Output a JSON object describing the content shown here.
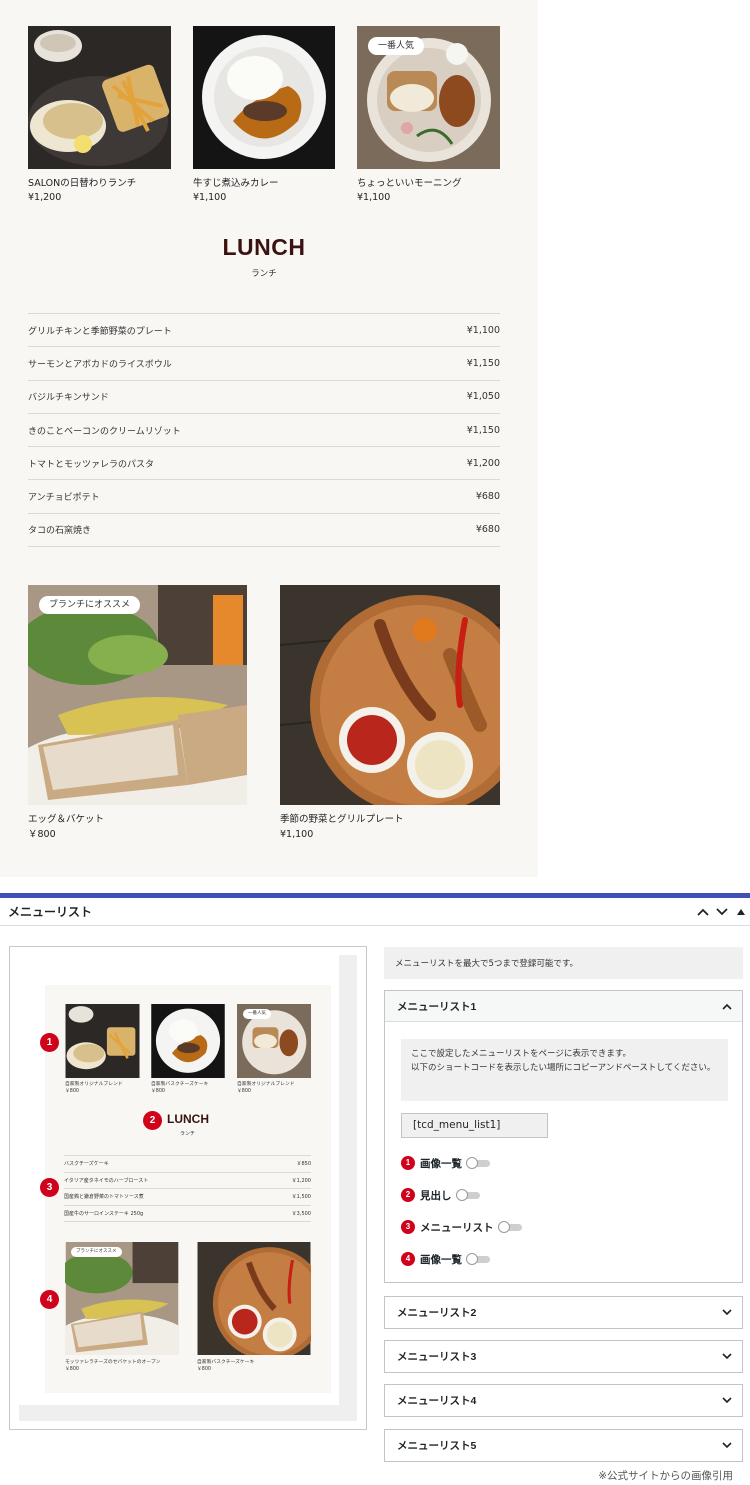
{
  "top": {
    "cards": [
      {
        "name": "SALONの日替わりランチ",
        "price": "¥1,200"
      },
      {
        "name": "牛すじ煮込みカレー",
        "price": "¥1,100"
      },
      {
        "name": "ちょっといいモーニング",
        "price": "¥1,100",
        "badge": "一番人気"
      }
    ],
    "lunch_title": "LUNCH",
    "lunch_sub": "ランチ",
    "menu": [
      {
        "name": "グリルチキンと季節野菜のプレート",
        "price": "¥1,100"
      },
      {
        "name": "サーモンとアボカドのライスボウル",
        "price": "¥1,150"
      },
      {
        "name": "バジルチキンサンド",
        "price": "¥1,050"
      },
      {
        "name": "きのことベーコンのクリームリゾット",
        "price": "¥1,150"
      },
      {
        "name": "トマトとモッツァレラのパスタ",
        "price": "¥1,200"
      },
      {
        "name": "アンチョビポテト",
        "price": "¥680"
      },
      {
        "name": "タコの石窯焼き",
        "price": "¥680"
      }
    ],
    "big_cards": [
      {
        "name": "エッグ＆バケット",
        "price": "￥800",
        "badge": "ブランチにオススメ"
      },
      {
        "name": "季節の野菜とグリルプレート",
        "price": "¥1,100"
      }
    ]
  },
  "panel": {
    "title": "メニューリスト",
    "controls": {
      "up": "∧",
      "down": "∨",
      "toggle": "▲"
    }
  },
  "preview": {
    "cards": [
      {
        "name": "自家製オリジナルブレンド",
        "price": "￥800"
      },
      {
        "name": "自家製バスクチーズケーキ",
        "price": "￥800"
      },
      {
        "name": "自家製オリジナルブレンド",
        "price": "￥800",
        "badge": "一番人気"
      }
    ],
    "lunch_title": "LUNCH",
    "lunch_sub": "ランチ",
    "menu": [
      {
        "name": "バスクチーズケーキ",
        "price": "￥850"
      },
      {
        "name": "イタリア産タネイモのハーブロースト",
        "price": "￥1,200"
      },
      {
        "name": "国産鶏と鎌倉野菜のトマトソース煮",
        "price": "￥1,500"
      },
      {
        "name": "国産牛のサーロインステーキ 250g",
        "price": "￥3,500"
      }
    ],
    "big_cards": [
      {
        "name": "モッツァレラチーズのせバケットのオーブン",
        "price": "￥800",
        "badge": "ブランチにオススメ"
      },
      {
        "name": "自家製バスクチーズケーキ",
        "price": "￥800"
      }
    ],
    "markers": [
      "1",
      "2",
      "3",
      "4"
    ]
  },
  "settings": {
    "info": "メニューリストを最大で5つまで登録可能です。",
    "lists": [
      {
        "label": "メニューリスト1",
        "open": true
      },
      {
        "label": "メニューリスト2"
      },
      {
        "label": "メニューリスト3"
      },
      {
        "label": "メニューリスト4"
      },
      {
        "label": "メニューリスト5"
      }
    ],
    "note_line1": "ここで設定したメニューリストをページに表示できます。",
    "note_line2": "以下のショートコードを表示したい場所にコピーアンドペーストしてください。",
    "shortcode": "[tcd_menu_list1]",
    "toggles": [
      {
        "num": "1",
        "label": "画像一覧"
      },
      {
        "num": "2",
        "label": "見出し"
      },
      {
        "num": "3",
        "label": "メニューリスト"
      },
      {
        "num": "4",
        "label": "画像一覧"
      }
    ],
    "chevron_up": "∧",
    "chevron_down": "∨"
  },
  "footnote": "※公式サイトからの画像引用",
  "colors": {
    "accent_bar": "#3f51b5",
    "marker": "#d0021b",
    "heading": "#3a1310"
  },
  "icons": [
    "chevron-up-icon",
    "chevron-down-icon",
    "triangle-up-icon",
    "food-photo"
  ]
}
